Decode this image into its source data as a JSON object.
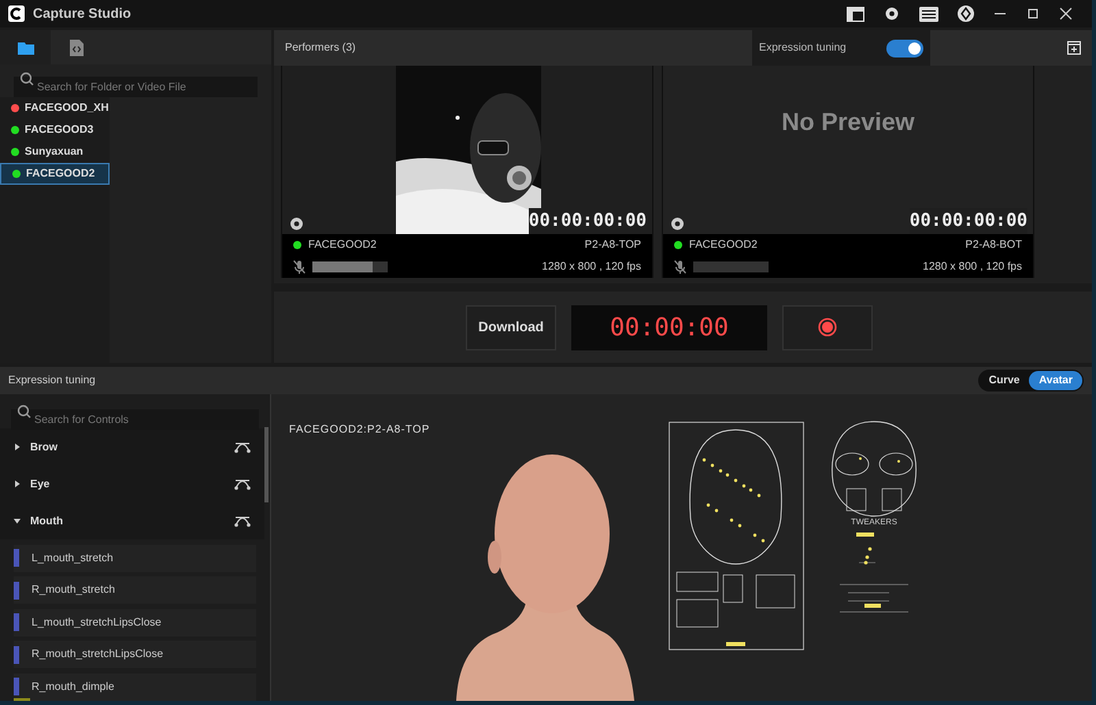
{
  "window": {
    "title": "Capture Studio"
  },
  "sidebar": {
    "tabs": [
      {
        "kind": "folder",
        "selected": true
      },
      {
        "kind": "file",
        "selected": false
      }
    ],
    "search": {
      "placeholder": "Search for Folder or Video File"
    },
    "items": [
      {
        "label": "FACEGOOD_XH",
        "color": "#ff4d4d",
        "selected": false
      },
      {
        "label": "FACEGOOD3",
        "color": "#22dd22",
        "selected": false
      },
      {
        "label": "Sunyaxuan",
        "color": "#22dd22",
        "selected": false
      },
      {
        "label": "FACEGOOD2",
        "color": "#22dd22",
        "selected": true
      }
    ]
  },
  "performers": {
    "title": "Performers (3)",
    "expression_tuning": {
      "label": "Expression tuning",
      "on": true
    },
    "cards": [
      {
        "preview": true,
        "timecode": "00:00:00:00",
        "name": "FACEGOOD2",
        "camera": "P2-A8-TOP",
        "format": "1280 x 800 , 120 fps",
        "level": 0.8,
        "color": "#22dd22"
      },
      {
        "preview": false,
        "no_preview_text": "No Preview",
        "timecode": "00:00:00:00",
        "name": "FACEGOOD2",
        "camera": "P2-A8-BOT",
        "format": "1280 x 800 , 120 fps",
        "level": 0.0,
        "color": "#22dd22"
      }
    ]
  },
  "controls": {
    "download": "Download",
    "timer": "00:00:00"
  },
  "tuning": {
    "title": "Expression tuning",
    "modes": [
      {
        "label": "Curve",
        "selected": false
      },
      {
        "label": "Avatar",
        "selected": true
      }
    ],
    "search": {
      "placeholder": "Search for Controls"
    },
    "groups": [
      {
        "label": "Brow",
        "expanded": false
      },
      {
        "label": "Eye",
        "expanded": false
      },
      {
        "label": "Mouth",
        "expanded": true,
        "children": [
          {
            "label": "L_mouth_stretch"
          },
          {
            "label": "R_mouth_stretch"
          },
          {
            "label": "L_mouth_stretchLipsClose"
          },
          {
            "label": "R_mouth_stretchLipsClose"
          },
          {
            "label": "R_mouth_dimple",
            "level": 0.1
          }
        ]
      }
    ],
    "viewport_label": "FACEGOOD2:P2-A8-TOP",
    "rig_label": "TWEAKERS"
  }
}
